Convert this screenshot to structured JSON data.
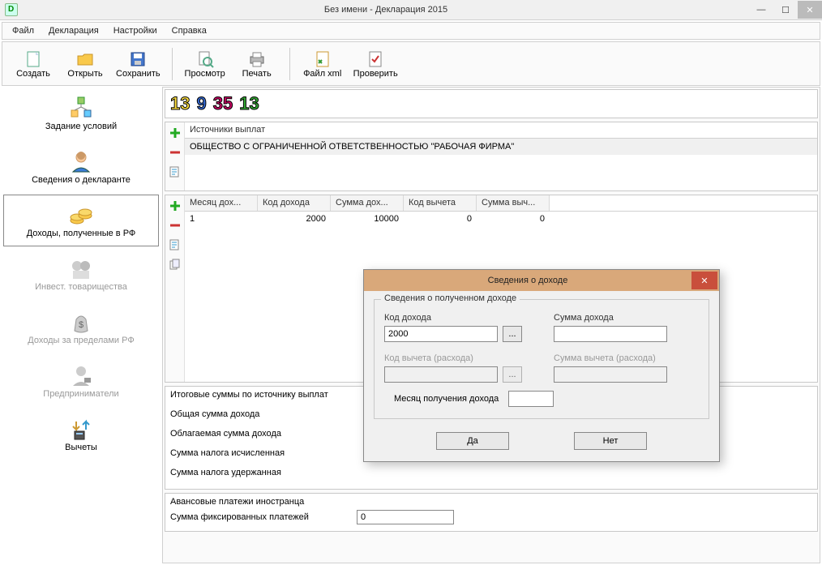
{
  "window": {
    "title": "Без имени - Декларация 2015"
  },
  "menu": {
    "file": "Файл",
    "decl": "Декларация",
    "settings": "Настройки",
    "help": "Справка"
  },
  "toolbar": {
    "create": "Создать",
    "open": "Открыть",
    "save": "Сохранить",
    "preview": "Просмотр",
    "print": "Печать",
    "xml": "Файл xml",
    "check": "Проверить"
  },
  "numtabs": {
    "a": "13",
    "b": "9",
    "c": "35",
    "d": "13"
  },
  "sidebar": {
    "items": [
      {
        "label": "Задание условий"
      },
      {
        "label": "Сведения о декларанте"
      },
      {
        "label": "Доходы, полученные в РФ"
      },
      {
        "label": "Инвест. товарищества"
      },
      {
        "label": "Доходы за пределами РФ"
      },
      {
        "label": "Предприниматели"
      },
      {
        "label": "Вычеты"
      }
    ]
  },
  "sources": {
    "header": "Источники выплат",
    "rows": [
      "ОБЩЕСТВО С ОГРАНИЧЕННОЙ ОТВЕТСТВЕННОСТЬЮ \"РАБОЧАЯ ФИРМА\""
    ]
  },
  "income_table": {
    "headers": [
      "Месяц дох...",
      "Код дохода",
      "Сумма дох...",
      "Код вычета",
      "Сумма выч..."
    ],
    "rows": [
      {
        "month": "1",
        "code": "2000",
        "sum": "10000",
        "dcode": "0",
        "dsum": "0"
      }
    ]
  },
  "totals": {
    "title": "Итоговые суммы по источнику выплат",
    "total_income": "Общая сумма дохода",
    "taxable_income": "Облагаемая сумма дохода",
    "tax_calc": "Сумма налога исчисленная",
    "tax_withheld": "Сумма налога удержанная"
  },
  "advance": {
    "title": "Авансовые платежи иностранца",
    "fixed_label": "Сумма фиксированных платежей",
    "fixed_value": "0"
  },
  "dialog": {
    "title": "Сведения о доходе",
    "group": "Сведения о полученном доходе",
    "code_label": "Код дохода",
    "code_value": "2000",
    "sum_label": "Сумма дохода",
    "sum_value": "",
    "dcode_label": "Код вычета (расхода)",
    "dcode_value": "",
    "dsum_label": "Сумма вычета (расхода)",
    "dsum_value": "",
    "month_label": "Месяц получения дохода",
    "month_value": "",
    "ok": "Да",
    "cancel": "Нет",
    "dots": "..."
  }
}
